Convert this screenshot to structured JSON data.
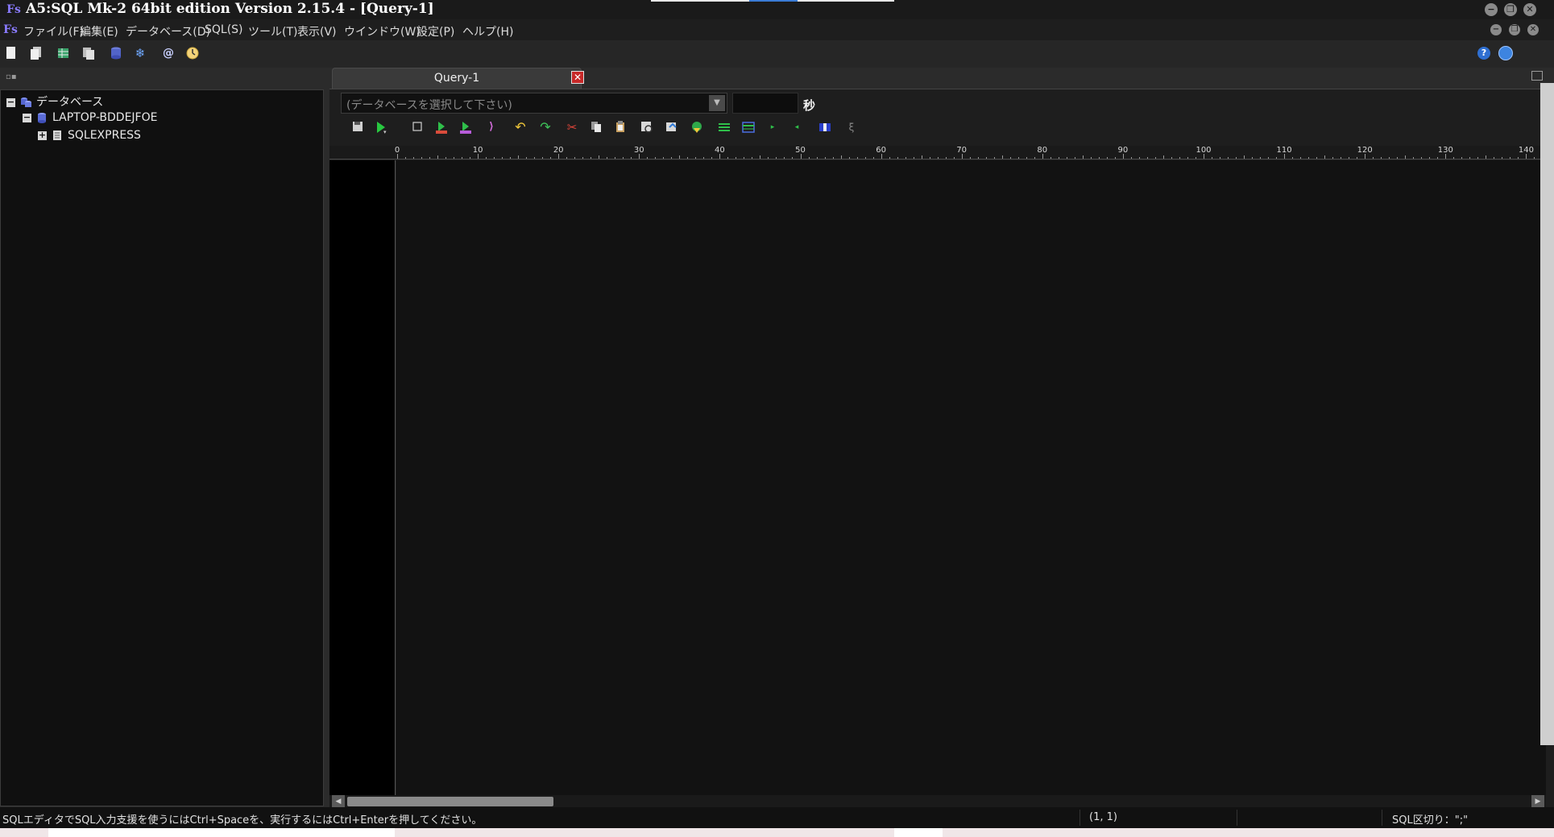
{
  "window": {
    "title": "A5:SQL Mk-2 64bit edition Version 2.15.4 - [Query-1]",
    "logo_glyph": "Fs"
  },
  "menu": [
    {
      "label": "ファイル(F)"
    },
    {
      "label": "編集(E)"
    },
    {
      "label": "データベース(D)"
    },
    {
      "label": "SQL(S)"
    },
    {
      "label": "ツール(T)"
    },
    {
      "label": "表示(V)"
    },
    {
      "label": "ウインドウ(W)"
    },
    {
      "label": "設定(P)"
    },
    {
      "label": "ヘルプ(H)"
    }
  ],
  "tree": {
    "root": {
      "label": "データベース",
      "expander": "−"
    },
    "server": {
      "label": "LAPTOP-BDDEJFOE",
      "expander": "−"
    },
    "instance": {
      "label": "SQLEXPRESS",
      "expander": "+"
    }
  },
  "query_tab": {
    "label": "Query-1",
    "close_glyph": "✕"
  },
  "query_toolbar": {
    "db_select_placeholder": "(データベースを選択して下さい)",
    "timeout_value": "",
    "timeout_unit": "秒"
  },
  "ruler": {
    "labels": [
      "0",
      "10",
      "20",
      "30",
      "40",
      "50",
      "60",
      "70",
      "80",
      "90",
      "100",
      "110",
      "120",
      "130",
      "140"
    ]
  },
  "status": {
    "hint": "SQLエディタでSQL入力支援を使うにはCtrl+Spaceを、実行するにはCtrl+Enterを押してください。",
    "cursor": "(1, 1)",
    "delimiter": "SQL区切り：\";\""
  },
  "icons": {
    "window_controls": [
      "minimize-icon",
      "restore-icon",
      "close-icon"
    ],
    "main_toolbar": [
      "new-file-icon",
      "open-file-icon",
      "table-icon",
      "copy-db-icon",
      "database-icon",
      "snowflake-icon",
      "at-sign-icon",
      "clock-icon"
    ],
    "query_toolbar": [
      "save-icon",
      "execute-icon",
      "stop-icon",
      "execute-all-icon",
      "explain-icon",
      "step-icon",
      "undo-icon",
      "redo-icon",
      "cut-icon",
      "copy-icon",
      "paste-icon",
      "find-icon",
      "format-icon",
      "import-icon",
      "grid-icon",
      "table-view-icon",
      "next-icon",
      "prev-icon",
      "layout-icon",
      "text-icon"
    ]
  }
}
